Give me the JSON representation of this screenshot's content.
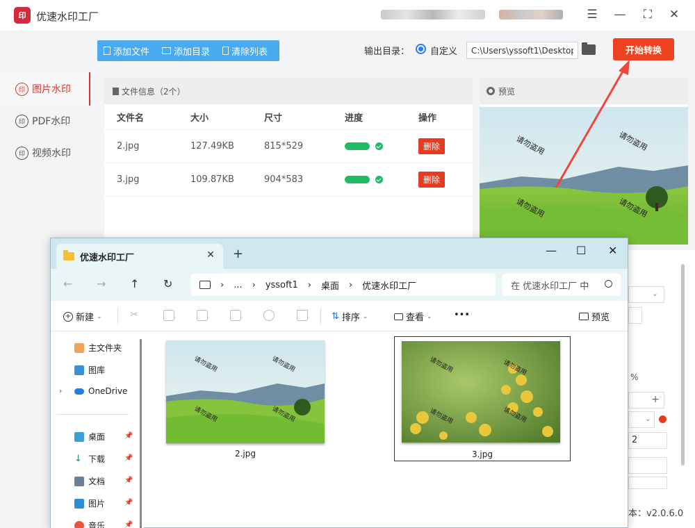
{
  "app": {
    "logo": "印",
    "title": "优速水印工厂",
    "toolbar": {
      "add_file": "添加文件",
      "add_folder": "添加目录",
      "clear_list": "清除列表"
    },
    "output": {
      "label": "输出目录：",
      "option": "自定义",
      "path": "C:\\Users\\yssoft1\\Desktop"
    },
    "start_button": "开始转换",
    "sidebar": [
      {
        "label": "图片水印",
        "icon": "image-watermark-icon",
        "active": true
      },
      {
        "label": "PDF水印",
        "icon": "pdf-watermark-icon",
        "active": false
      },
      {
        "label": "视频水印",
        "icon": "video-watermark-icon",
        "active": false
      }
    ],
    "file_panel": {
      "title": "文件信息（2个）",
      "columns": [
        "文件名",
        "大小",
        "尺寸",
        "进度",
        "操作"
      ],
      "rows": [
        {
          "name": "2.jpg",
          "size": "127.49KB",
          "dims": "815*529",
          "progress": 1.0,
          "action": "删除"
        },
        {
          "name": "3.jpg",
          "size": "109.87KB",
          "dims": "904*583",
          "progress": 1.0,
          "action": "删除"
        }
      ]
    },
    "preview": {
      "title": "预览",
      "watermark": "请勿盗用"
    },
    "right_controls": {
      "percent": "%",
      "plus": "+",
      "value": "2"
    },
    "version": "本：v2.0.6.0",
    "colors": {
      "accent": "#e0352b",
      "start": "#ee4221",
      "toolbar": "#4aaaf0",
      "progress": "#1fba62"
    }
  },
  "explorer": {
    "tab": "优速水印工厂",
    "breadcrumb": [
      "...",
      "yssoft1",
      "桌面",
      "优速水印工厂"
    ],
    "search_placeholder": "在 优速水印工厂 中",
    "commands": {
      "new": "新建",
      "sort": "排序",
      "view": "查看",
      "more": "•••",
      "preview": "预览"
    },
    "nav": [
      {
        "label": "主文件夹",
        "icon": "home-icon"
      },
      {
        "label": "图库",
        "icon": "gallery-icon"
      },
      {
        "label": "OneDrive",
        "icon": "onedrive-icon"
      },
      {
        "label": "桌面",
        "icon": "desktop-icon"
      },
      {
        "label": "下载",
        "icon": "download-icon"
      },
      {
        "label": "文档",
        "icon": "document-icon"
      },
      {
        "label": "图片",
        "icon": "pictures-icon"
      },
      {
        "label": "音乐",
        "icon": "music-icon"
      }
    ],
    "files": [
      {
        "name": "2.jpg",
        "selected": false
      },
      {
        "name": "3.jpg",
        "selected": true
      }
    ]
  }
}
